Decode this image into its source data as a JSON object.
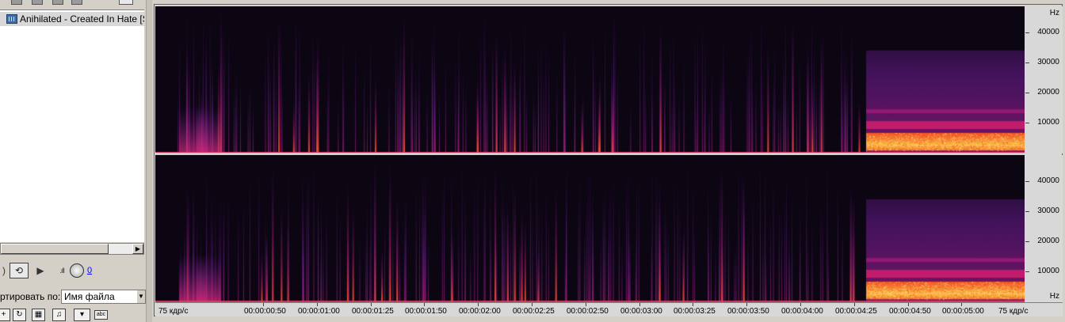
{
  "left_panel": {
    "file_item": {
      "label": "Anihilated - Created In Hate [Side"
    },
    "transport": {
      "volume_value": "0"
    },
    "sort": {
      "label": "ртировать по:",
      "value": "Имя файла"
    }
  },
  "spectrogram": {
    "channels": [
      "top",
      "bottom"
    ],
    "freq_axis": {
      "unit": "Hz",
      "top_channel_labels": [
        "40000",
        "30000",
        "20000",
        "10000"
      ],
      "bottom_channel_labels": [
        "40000",
        "30000",
        "20000",
        "10000"
      ],
      "bottom_unit": "Hz"
    },
    "time_axis": {
      "left_rate": "75 кдр/с",
      "right_rate": "75 кдр/с",
      "labels": [
        "00:00:00:50",
        "00:00:01:00",
        "00:00:01:25",
        "00:00:01:50",
        "00:00:02:00",
        "00:00:02:25",
        "00:00:02:50",
        "00:00:03:00",
        "00:00:03:25",
        "00:00:03:50",
        "00:00:04:00",
        "00:00:04:25",
        "00:00:04:50",
        "00:00:05:00"
      ]
    },
    "colors": {
      "background": "#0c0512",
      "low": "#3a1452",
      "mid": "#b0157a",
      "high": "#ff5a1a",
      "peak": "#ffe46b"
    }
  }
}
